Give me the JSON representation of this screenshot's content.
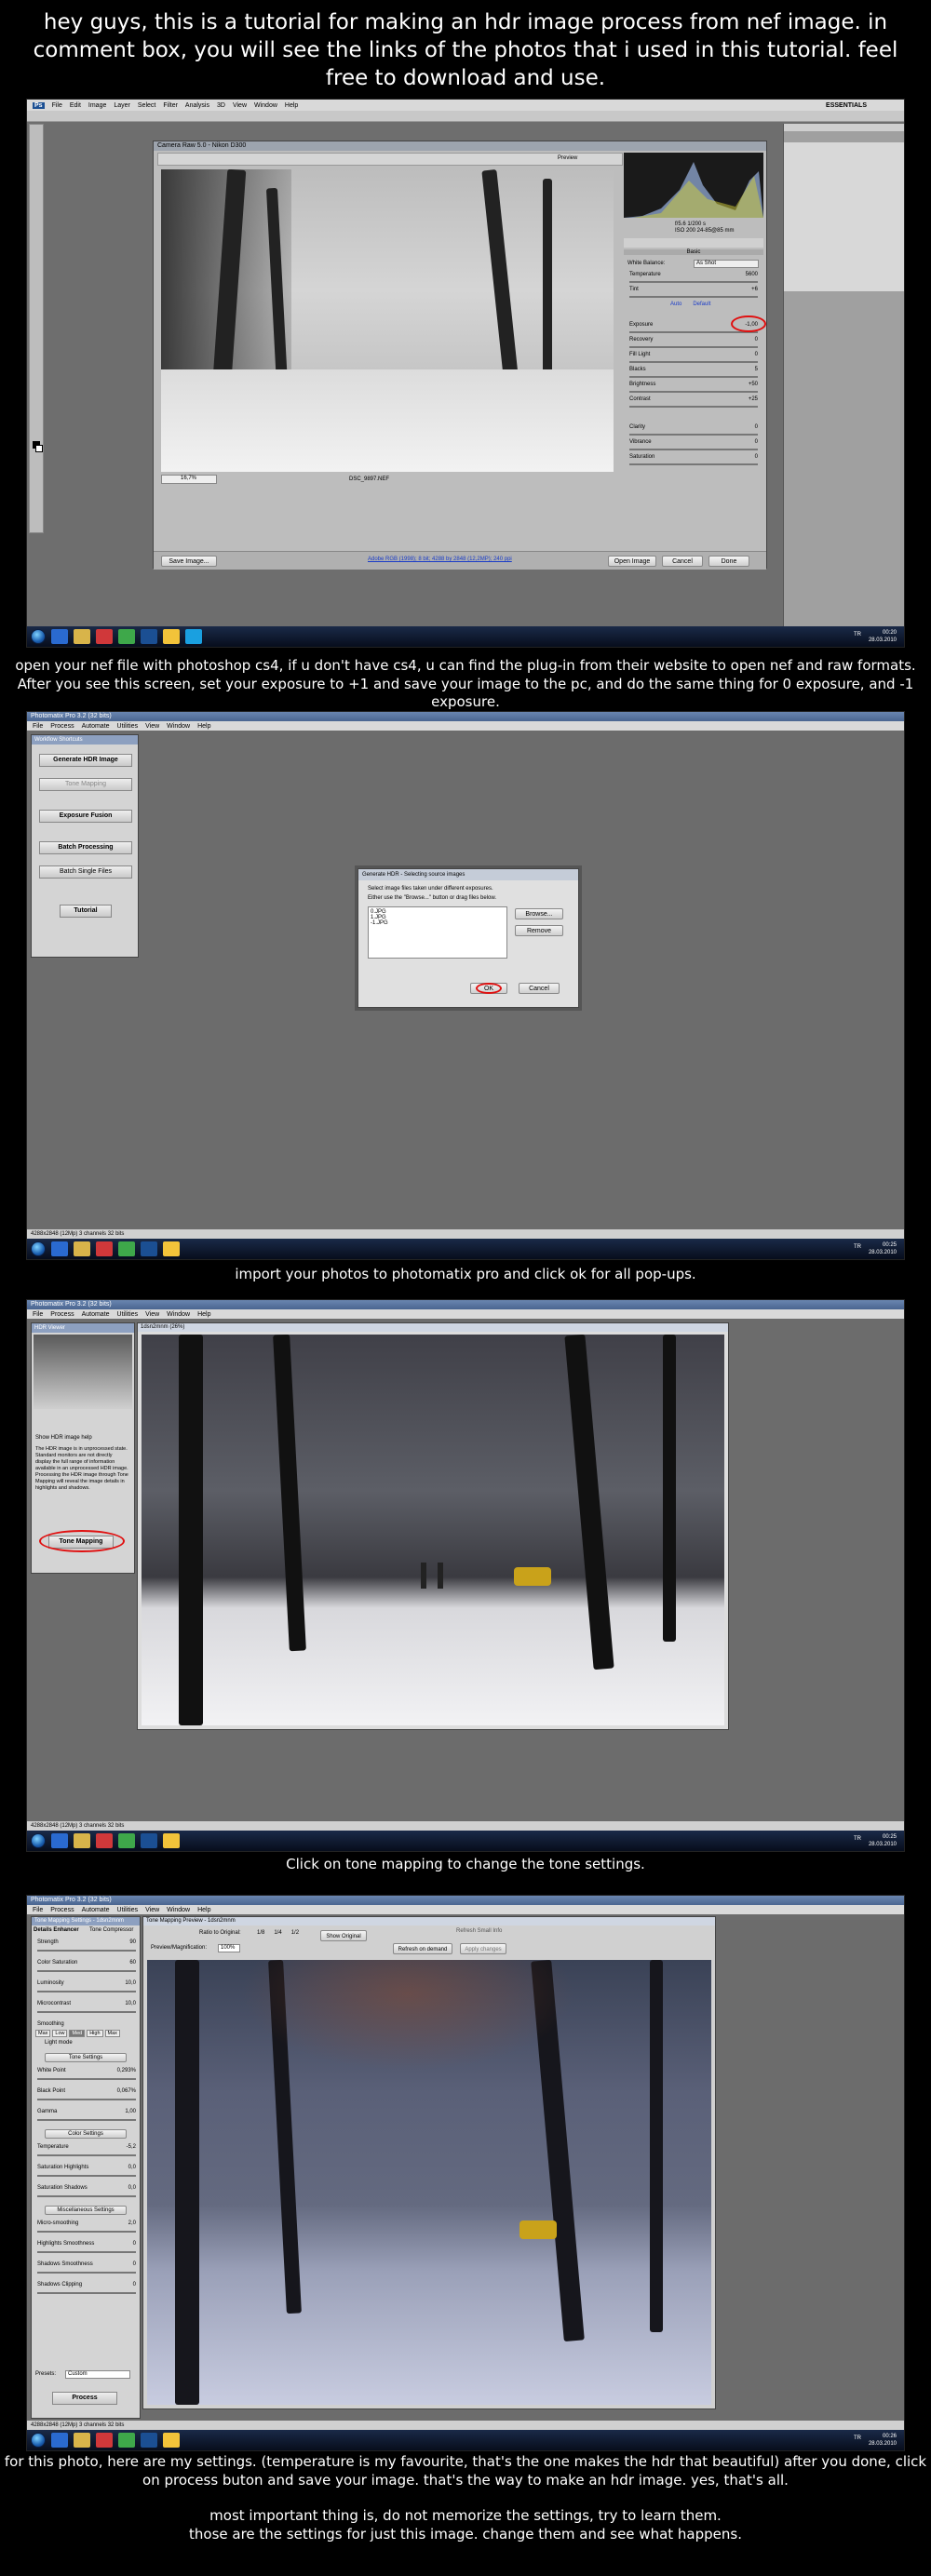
{
  "intro_caption": "hey guys, this is a tutorial for making an hdr image process from nef image.  in comment box, you will see the links of the photos that i used in this tutorial. feel free to download and use.",
  "step1": {
    "caption": "open your nef file with photoshop cs4, if u don't have cs4, u can find the plug-in from their website to open nef and raw formats. After you see this screen, set your exposure to +1 and save your image to the pc, and do the same thing for 0 exposure, and -1 exposure.",
    "menu": [
      "File",
      "Edit",
      "Image",
      "Layer",
      "Select",
      "Filter",
      "Analysis",
      "3D",
      "View",
      "Window",
      "Help"
    ],
    "essentials": "ESSENTIALS",
    "dialog_title": "Camera Raw 5.0  -  Nikon D300",
    "preview_label": "Preview",
    "readout_top": [
      "f/5.6  1/200 s",
      "ISO 200  24-85@85 mm"
    ],
    "wb_label": "White Balance:",
    "wb_value": "As Shot",
    "links": [
      "Auto",
      "Default"
    ],
    "sliders": [
      {
        "label": "Temperature",
        "value": "5600"
      },
      {
        "label": "Tint",
        "value": "+6"
      },
      {
        "label": "Exposure",
        "value": "-1,00"
      },
      {
        "label": "Recovery",
        "value": "0"
      },
      {
        "label": "Fill Light",
        "value": "0"
      },
      {
        "label": "Blacks",
        "value": "5"
      },
      {
        "label": "Brightness",
        "value": "+50"
      },
      {
        "label": "Contrast",
        "value": "+25"
      },
      {
        "label": "Clarity",
        "value": "0"
      },
      {
        "label": "Vibrance",
        "value": "0"
      },
      {
        "label": "Saturation",
        "value": "0"
      }
    ],
    "basic_tab": "Basic",
    "zoom": "16,7%",
    "filename": "DSC_9897.NEF",
    "workflow_link": "Adobe RGB (1998); 8 bit; 4288 by 2848 (12,2MP); 240 ppi",
    "save_button": "Save Image...",
    "open_button": "Open Image",
    "cancel_button": "Cancel",
    "done_button": "Done"
  },
  "step2": {
    "caption": "import your photos to photomatix pro and click ok for all pop-ups.",
    "app_title": "Photomatix Pro 3.2 (32 bits)",
    "menu": [
      "File",
      "Process",
      "Automate",
      "Utilities",
      "View",
      "Window",
      "Help"
    ],
    "panel_title": "Workflow Shortcuts",
    "buttons": [
      "Generate HDR Image",
      "Tone Mapping",
      "Exposure Fusion",
      "Batch Processing",
      "Batch Single Files",
      "Tutorial"
    ],
    "dialog_title": "Generate HDR - Selecting source images",
    "dialog_text1": "Select image files taken under different exposures.",
    "dialog_text2": "Either use the \"Browse...\" button or drag files below.",
    "files": [
      "0.JPG",
      "1.JPG",
      "-1.JPG"
    ],
    "browse": "Browse...",
    "remove": "Remove",
    "ok": "OK",
    "cancel": "Cancel",
    "status": "4288x2848 (12Mp) 3 channels 32 bits"
  },
  "step3": {
    "caption": "Click on tone mapping to change the tone settings.",
    "app_title": "Photomatix Pro 3.2 (32 bits)",
    "menu": [
      "File",
      "Process",
      "Automate",
      "Utilities",
      "View",
      "Window",
      "Help"
    ],
    "viewer_title": "HDR Viewer",
    "doc_title": "1dsn2mnm (26%)",
    "checkbox": "Show HDR image help",
    "help_text": "The HDR image is in unprocessed state. Standard monitors are not directly display the full range of information available in an unprocessed HDR image. Processing the HDR image through Tone Mapping will reveal the image details in highlights and shadows.",
    "tone_button": "Tone Mapping",
    "status": "4288x2848 (12Mp) 3 channels 32 bits"
  },
  "step4": {
    "caption": "for this photo, here are my settings. (temperature is my favourite, that's the one makes the hdr that beautiful) after you done, click on process buton and save your image. that's the way to make an hdr image.  yes, that's all.",
    "app_title": "Photomatix Pro 3.2 (32 bits)",
    "menu": [
      "File",
      "Process",
      "Automate",
      "Utilities",
      "View",
      "Window",
      "Help"
    ],
    "settings_title": "Tone Mapping Settings - 1dsn2mnm",
    "tabs": [
      "Details Enhancer",
      "Tone Compressor"
    ],
    "settings": [
      {
        "label": "Strength",
        "value": "90"
      },
      {
        "label": "Color Saturation",
        "value": "60"
      },
      {
        "label": "Luminosity",
        "value": "10,0"
      },
      {
        "label": "Microcontrast",
        "value": "10,0"
      }
    ],
    "smoothing_label": "Smoothing",
    "smoothing_levels": [
      "Max",
      "Low",
      "Med",
      "High",
      "Max"
    ],
    "light_mode": "Light mode",
    "tone_section": "Tone Settings",
    "tone": [
      {
        "label": "White Point",
        "value": "0,293%"
      },
      {
        "label": "Black Point",
        "value": "0,067%"
      },
      {
        "label": "Gamma",
        "value": "1,00"
      }
    ],
    "color_section": "Color Settings",
    "color": [
      {
        "label": "Temperature",
        "value": "-5,2"
      },
      {
        "label": "Saturation Highlights",
        "value": "0,0"
      },
      {
        "label": "Saturation Shadows",
        "value": "0,0"
      }
    ],
    "misc_section": "Miscellaneous Settings",
    "misc": [
      {
        "label": "Micro-smoothing",
        "value": "2,0"
      },
      {
        "label": "Highlights Smoothness",
        "value": "0"
      },
      {
        "label": "Shadows Smoothness",
        "value": "0"
      },
      {
        "label": "Shadows Clipping",
        "value": "0"
      }
    ],
    "presets_label": "Presets:",
    "presets_value": "Custom",
    "process_button": "Process",
    "preview_title": "Tone Mapping Preview - 1dsn2mnm",
    "ratio_label": "Ratio to Original:",
    "ratios": [
      "1/8",
      "1/4",
      "1/2"
    ],
    "show_original": "Show Original",
    "refresh_label": "Refresh Small Info",
    "preview_mag": "Preview/Magnification:",
    "mag_value": "100%",
    "refresh_demand": "Refresh on demand",
    "apply_changes": "Apply changes",
    "status": "4288x2848 (12Mp) 3 channels 32 bits"
  },
  "outro1": "most important thing is, do not memorize the settings, try to learn them.",
  "outro2": "those are the settings for just this image. change them and see what happens.",
  "taskbar": {
    "lang": "TR",
    "times": [
      "00:20",
      "00:25",
      "00:25",
      "00:26"
    ],
    "date": "28.03.2010"
  }
}
